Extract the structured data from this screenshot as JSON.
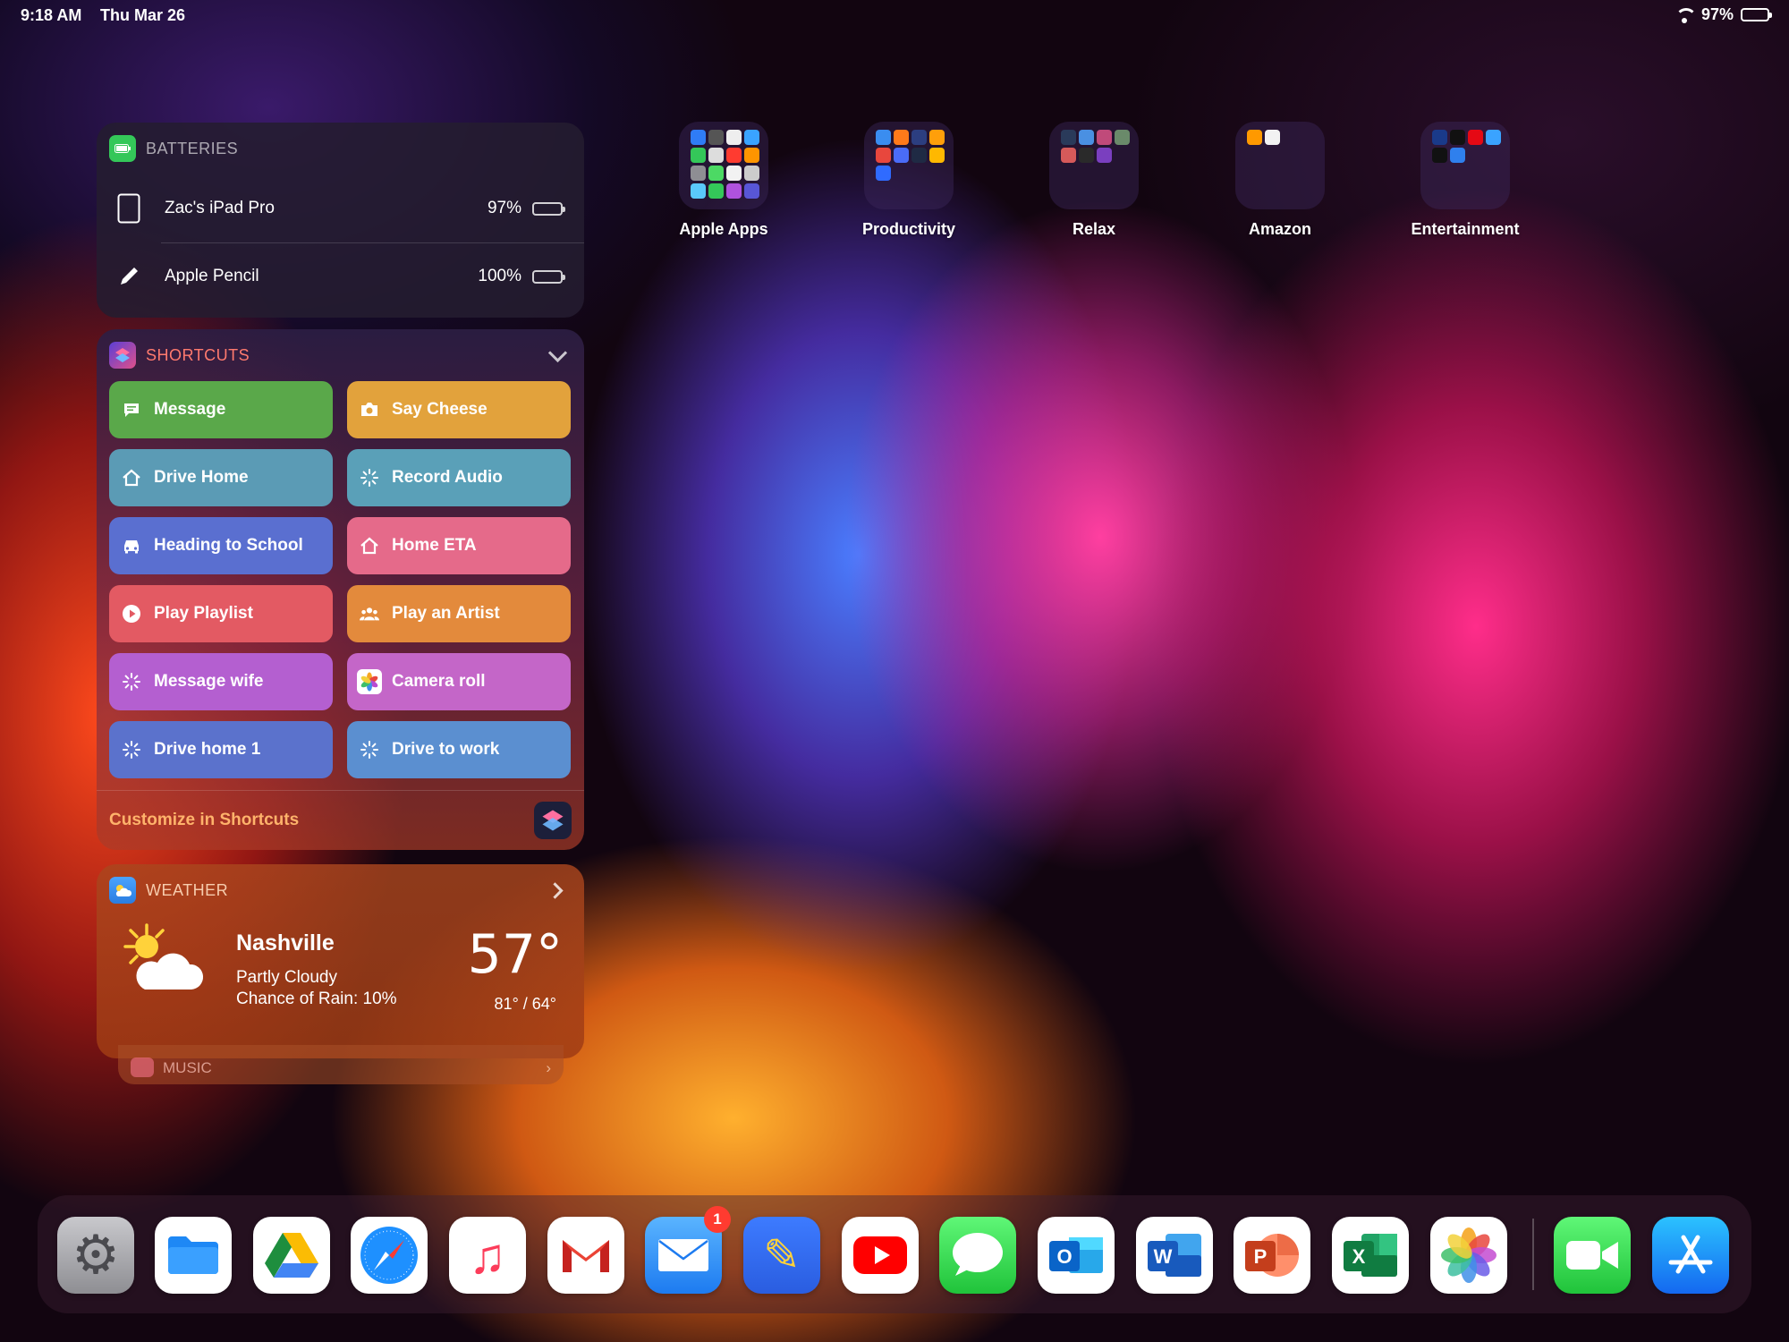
{
  "status_bar": {
    "time": "9:18 AM",
    "date": "Thu Mar 26",
    "battery_pct": "97%"
  },
  "batteries": {
    "title": "BATTERIES",
    "devices": [
      {
        "name": "Zac's iPad Pro",
        "percent": "97%",
        "level": 0.97
      },
      {
        "name": "Apple Pencil",
        "percent": "100%",
        "level": 1.0
      }
    ]
  },
  "shortcuts": {
    "title": "SHORTCUTS",
    "buttons": [
      {
        "label": "Message",
        "color": "#5aa84a"
      },
      {
        "label": "Say Cheese",
        "color": "#e2a23c"
      },
      {
        "label": "Drive Home",
        "color": "#5b9bb5"
      },
      {
        "label": "Record Audio",
        "color": "#5aa0b8"
      },
      {
        "label": "Heading to School",
        "color": "#5a6fd0"
      },
      {
        "label": "Home ETA",
        "color": "#e56a8a"
      },
      {
        "label": "Play Playlist",
        "color": "#e35a63"
      },
      {
        "label": "Play an Artist",
        "color": "#e38a3c"
      },
      {
        "label": "Message wife",
        "color": "#b45fd0"
      },
      {
        "label": "Camera roll",
        "color": "#c466c8"
      },
      {
        "label": "Drive home 1",
        "color": "#5b72cc"
      },
      {
        "label": "Drive to work",
        "color": "#5b8fd0"
      }
    ],
    "footer": "Customize in Shortcuts"
  },
  "weather": {
    "title": "WEATHER",
    "city": "Nashville",
    "condition": "Partly Cloudy",
    "rain": "Chance of Rain: 10%",
    "temp": "57°",
    "range": "81° / 64°"
  },
  "music": {
    "title": "MUSIC"
  },
  "folders": [
    {
      "label": "Apple Apps"
    },
    {
      "label": "Productivity"
    },
    {
      "label": "Relax"
    },
    {
      "label": "Amazon"
    },
    {
      "label": "Entertainment"
    }
  ],
  "dock": {
    "apps": [
      {
        "name": "Settings",
        "glyph": "⚙"
      },
      {
        "name": "Files",
        "glyph": ""
      },
      {
        "name": "Google Drive",
        "glyph": "▲"
      },
      {
        "name": "Safari",
        "glyph": "✦"
      },
      {
        "name": "Music",
        "glyph": "♫"
      },
      {
        "name": "Gmail",
        "glyph": "M"
      },
      {
        "name": "Mail",
        "glyph": "✉",
        "badge": "1"
      },
      {
        "name": "Notability",
        "glyph": "✎"
      },
      {
        "name": "YouTube",
        "glyph": "▶"
      },
      {
        "name": "Messages",
        "glyph": "💬"
      },
      {
        "name": "Outlook",
        "glyph": "O"
      },
      {
        "name": "Word",
        "glyph": "W"
      },
      {
        "name": "PowerPoint",
        "glyph": "P"
      },
      {
        "name": "Excel",
        "glyph": "X"
      },
      {
        "name": "Photos",
        "glyph": "✿"
      },
      {
        "name": "FaceTime",
        "glyph": "■"
      },
      {
        "name": "App Store",
        "glyph": "A"
      }
    ]
  }
}
